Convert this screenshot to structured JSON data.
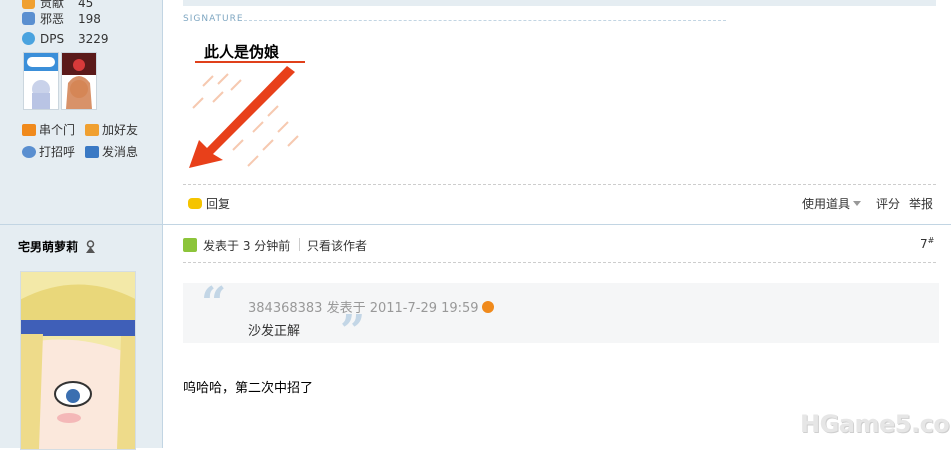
{
  "profile_top": {
    "stats": [
      {
        "label": "贡献",
        "value": "45",
        "icon": "contribution-icon",
        "color": "#f0a030"
      },
      {
        "label": "邪恶",
        "value": "198",
        "icon": "evil-icon",
        "color": "#5a8fd0"
      },
      {
        "label": "DPS",
        "value": "3229",
        "icon": "star-icon",
        "color": "#4aa3df"
      }
    ],
    "actions": [
      {
        "label": "串个门",
        "icon": "home-icon",
        "color": "#f08a1c"
      },
      {
        "label": "加好友",
        "icon": "handshake-icon",
        "color": "#f0a030"
      },
      {
        "label": "打招呼",
        "icon": "greet-icon",
        "color": "#5a8fd0"
      },
      {
        "label": "发消息",
        "icon": "message-icon",
        "color": "#3a79c4"
      }
    ]
  },
  "signature": {
    "label": "SIGNATURE",
    "text": "此人是伪娘"
  },
  "post_actions": {
    "reply": "回复",
    "use_item": "使用道具",
    "rate": "评分",
    "report": "举报"
  },
  "post2": {
    "username": "宅男萌萝莉",
    "posted_at": "发表于 3 分钟前",
    "only_author": "只看该作者",
    "floor": "7",
    "floor_sup": "#",
    "quote_author_line": "384368383 发表于 2011-7-29 19:59",
    "quote_text": "沙发正解",
    "content": "呜哈哈，第二次中招了"
  },
  "watermark": "HGame5.com"
}
